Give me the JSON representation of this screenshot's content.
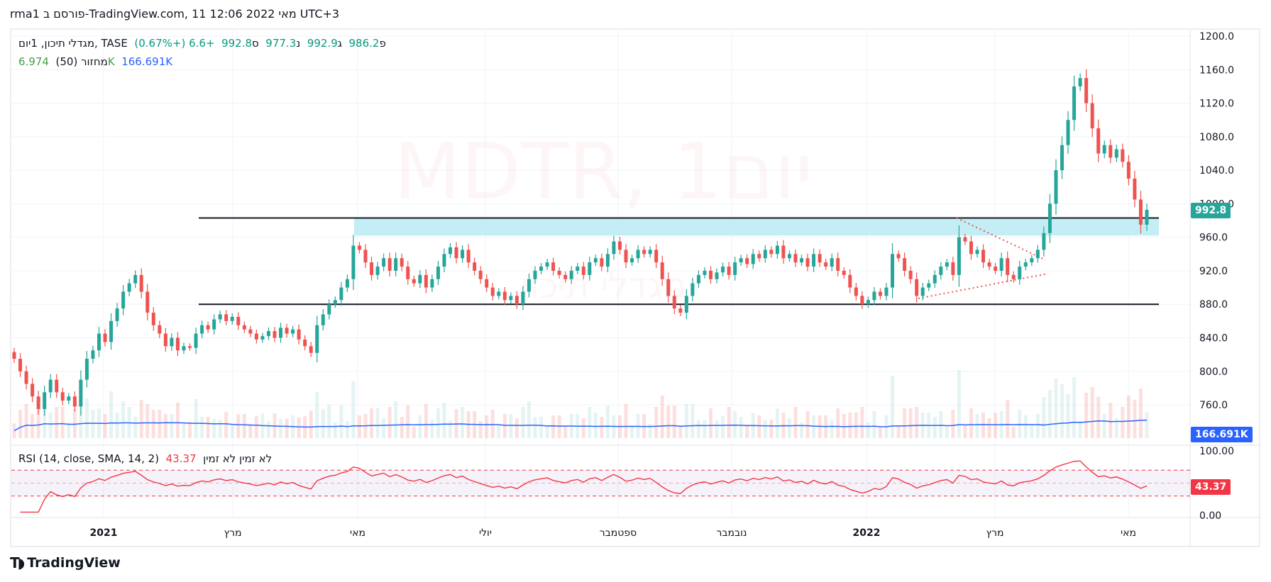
{
  "published": "rma1 פורסם ב-TradingView.com, 11 מאי 2022 12:06 UTC+3",
  "legend": {
    "title": "מגדלי תיכון, 1יום, TASE",
    "open_label": "פ",
    "open": "986.2",
    "high_label": "ג",
    "high": "992.9",
    "low_label": "נ",
    "low": "977.3",
    "close_label": "ס",
    "close": "992.8",
    "change": "+6.6 (+0.67%)",
    "volume_title": "מחזור (50)",
    "volume_value": "6.974K",
    "volume_ma": "166.691K",
    "rsi_title": "RSI (14, close, SMA, 14, 2)",
    "rsi_value": "43.37",
    "rsi_na": "לא זמין  לא זמין"
  },
  "watermark": {
    "symbol": "MDTR, 1יום",
    "name": "מגדלי תיכון"
  },
  "tags": {
    "price": "992.8",
    "volume_ma": "166.691K",
    "rsi": "43.37"
  },
  "logo": "TradingView",
  "colors": {
    "up": "#26a69a",
    "down": "#ef5350",
    "zone": "#c4eef5",
    "rsi": "#f23645",
    "volume_ma": "#2962ff",
    "price_tag": "#26a69a",
    "volume_tag": "#2962ff",
    "rsi_tag": "#f23645"
  },
  "chart_data": {
    "type": "candlestick",
    "interval": "1 day",
    "y_axis": {
      "min": 760,
      "max": 1200,
      "ticks": [
        "1200.0",
        "1160.0",
        "1120.0",
        "1080.0",
        "1040.0",
        "1000.0",
        "960.0",
        "920.0",
        "880.0",
        "840.0",
        "800.0",
        "760.0"
      ]
    },
    "rsi_axis": {
      "ticks": [
        "100.00",
        "50.00",
        "0.00"
      ],
      "bands": [
        70,
        50,
        30
      ]
    },
    "x_ticks": [
      "2021",
      "מרץ",
      "מאי",
      "יולי",
      "ספטמבר",
      "נובמבר",
      "2022",
      "מרץ",
      "מאי"
    ],
    "closes": [
      815,
      800,
      785,
      770,
      755,
      775,
      790,
      775,
      765,
      770,
      758,
      790,
      815,
      825,
      845,
      835,
      860,
      875,
      895,
      905,
      915,
      895,
      870,
      855,
      845,
      830,
      840,
      825,
      830,
      828,
      845,
      855,
      850,
      862,
      868,
      860,
      865,
      855,
      850,
      845,
      838,
      842,
      848,
      840,
      852,
      845,
      850,
      838,
      830,
      822,
      855,
      868,
      880,
      885,
      900,
      910,
      950,
      945,
      930,
      915,
      925,
      935,
      920,
      935,
      925,
      910,
      905,
      915,
      900,
      910,
      925,
      940,
      948,
      935,
      945,
      930,
      920,
      910,
      900,
      890,
      895,
      885,
      890,
      880,
      895,
      910,
      920,
      925,
      930,
      920,
      915,
      910,
      920,
      925,
      915,
      930,
      935,
      925,
      940,
      955,
      945,
      930,
      935,
      945,
      940,
      945,
      930,
      910,
      890,
      875,
      870,
      890,
      905,
      915,
      920,
      910,
      918,
      925,
      915,
      930,
      935,
      928,
      940,
      935,
      945,
      940,
      950,
      935,
      940,
      930,
      935,
      925,
      940,
      930,
      925,
      935,
      920,
      915,
      900,
      890,
      880,
      885,
      895,
      890,
      900,
      940,
      935,
      920,
      910,
      890,
      900,
      905,
      915,
      925,
      930,
      915,
      960,
      955,
      940,
      945,
      930,
      925,
      920,
      935,
      915,
      910,
      925,
      930,
      935,
      945,
      965,
      1000,
      1040,
      1070,
      1100,
      1140,
      1150,
      1120,
      1090,
      1060,
      1070,
      1055,
      1065,
      1050,
      1030,
      1005,
      975,
      992.8
    ],
    "drawings": {
      "horizontal_lines": [
        983,
        880
      ],
      "resistance_zone": [
        962,
        983
      ],
      "triangle_upper": [
        983,
        933
      ],
      "triangle_lower": [
        887,
        916
      ]
    }
  }
}
